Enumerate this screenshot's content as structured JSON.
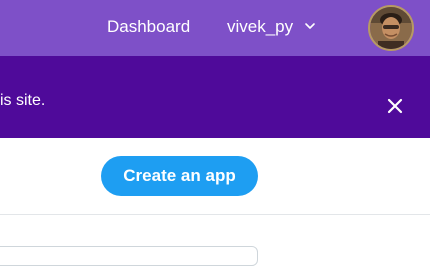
{
  "topbar": {
    "background": "#7e50c8",
    "links": {
      "dashboard": "Dashboard",
      "username": "vivek_py"
    },
    "user_menu_icon": "chevron-down-icon",
    "avatar_icon": "user-avatar"
  },
  "banner": {
    "background": "#4f0a9a",
    "message": "is site.",
    "close_icon": "close-icon"
  },
  "actions": {
    "create_app_label": "Create an app",
    "create_app_color": "#1e9ef2"
  }
}
